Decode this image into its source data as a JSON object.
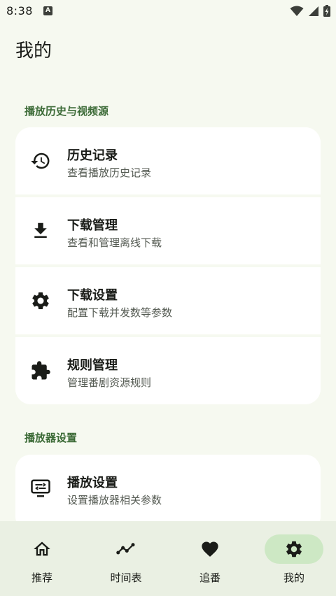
{
  "status_bar": {
    "time": "8:38",
    "notification_letter": "A"
  },
  "page": {
    "title": "我的"
  },
  "sections": [
    {
      "header": "播放历史与视频源",
      "items": [
        {
          "icon": "history-icon",
          "title": "历史记录",
          "subtitle": "查看播放历史记录"
        },
        {
          "icon": "download-icon",
          "title": "下载管理",
          "subtitle": "查看和管理离线下载"
        },
        {
          "icon": "gear-icon",
          "title": "下载设置",
          "subtitle": "配置下载并发数等参数"
        },
        {
          "icon": "puzzle-icon",
          "title": "规则管理",
          "subtitle": "管理番剧资源规则"
        }
      ]
    },
    {
      "header": "播放器设置",
      "items": [
        {
          "icon": "player-settings-icon",
          "title": "播放设置",
          "subtitle": "设置播放器相关参数"
        }
      ]
    }
  ],
  "bottom_nav": {
    "active": "我的",
    "tabs": [
      {
        "icon": "home-icon",
        "label": "推荐"
      },
      {
        "icon": "timeline-icon",
        "label": "时间表"
      },
      {
        "icon": "heart-icon",
        "label": "追番"
      },
      {
        "icon": "gear-icon",
        "label": "我的"
      }
    ]
  },
  "colors": {
    "background": "#f6f9f0",
    "section_header": "#3b6a36",
    "card": "#ffffff",
    "nav_background": "#eaf0e3",
    "nav_active_pill": "#cde8c4"
  }
}
